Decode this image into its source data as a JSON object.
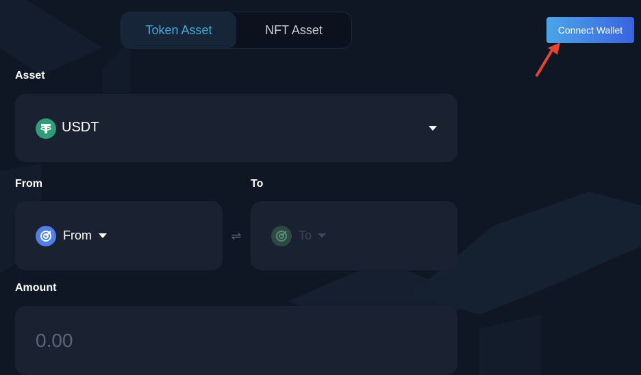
{
  "tabs": [
    {
      "label": "Token Asset",
      "active": true
    },
    {
      "label": "NFT Asset",
      "active": false
    }
  ],
  "header": {
    "connect_label": "Connect Wallet"
  },
  "asset": {
    "label": "Asset",
    "selected": "USDT",
    "icon": "tether-icon"
  },
  "from": {
    "label": "From",
    "selected": "From",
    "icon": "chain-icon"
  },
  "to": {
    "label": "To",
    "selected": "To",
    "icon": "chain-icon"
  },
  "amount": {
    "label": "Amount",
    "placeholder": "0.00"
  },
  "colors": {
    "background": "#0f1624",
    "panel": "#1a2130",
    "accent": "#4aa8d8",
    "button_start": "#4aa6e8",
    "button_end": "#3a63e0",
    "tether": "#2d9e76",
    "annotation_arrow": "#e8452c"
  }
}
